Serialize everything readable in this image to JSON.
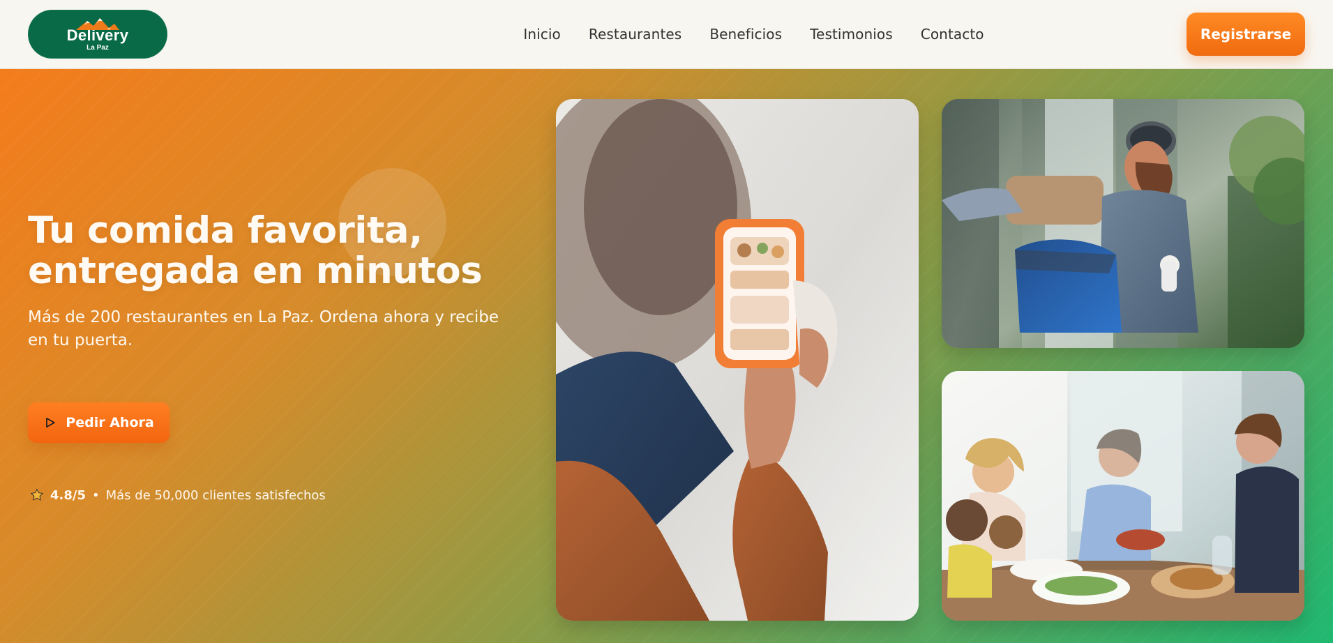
{
  "header": {
    "logo": {
      "title": "Delivery",
      "subtitle": "La Paz"
    },
    "nav": [
      {
        "label": "Inicio"
      },
      {
        "label": "Restaurantes"
      },
      {
        "label": "Beneficios"
      },
      {
        "label": "Testimonios"
      },
      {
        "label": "Contacto"
      }
    ],
    "register_label": "Registrarse"
  },
  "hero": {
    "title_line_1": "Tu comida favorita,",
    "title_line_2": "entregada en minutos",
    "subtitle": "Más de 200 restaurantes en La Paz. Ordena ahora y recibe en tu puerta.",
    "order_label": "Pedir Ahora",
    "rating_value": "4.8/5",
    "rating_separator": "•",
    "rating_text": "Más de 50,000 clientes satisfechos"
  },
  "icons": {
    "logo_mark": "mountain-logo-icon",
    "order_button": "play-triangle-icon",
    "rating": "star-icon"
  },
  "colors": {
    "header_bg": "#f8f6f1",
    "logo_bg": "#096a47",
    "accent_orange": "#f06b0f",
    "accent_green": "#20b870",
    "nav_text": "#313131"
  }
}
